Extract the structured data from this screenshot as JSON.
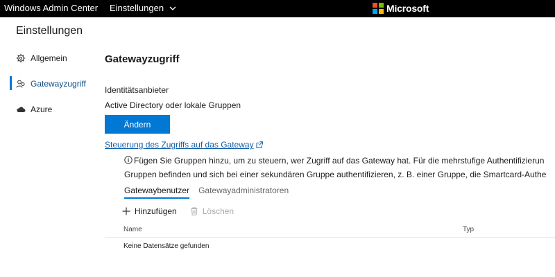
{
  "header": {
    "app_title": "Windows Admin Center",
    "nav_label": "Einstellungen",
    "brand": "Microsoft",
    "brand_colors": [
      "#f25022",
      "#7fba00",
      "#00a4ef",
      "#ffb900"
    ]
  },
  "page": {
    "heading": "Einstellungen"
  },
  "sidebar": {
    "items": [
      {
        "label": "Allgemein",
        "icon": "gear-icon",
        "active": false
      },
      {
        "label": "Gatewayzugriff",
        "icon": "people-icon",
        "active": true
      },
      {
        "label": "Azure",
        "icon": "cloud-icon",
        "active": false
      }
    ]
  },
  "main": {
    "title": "Gatewayzugriff",
    "provider_label": "Identitätsanbieter",
    "provider_value": "Active Directory oder lokale Gruppen",
    "change_button": "Ändern",
    "help_link": "Steuerung des Zugriffs auf das Gateway",
    "info_line1": "Fügen Sie Gruppen hinzu, um zu steuern, wer Zugriff auf das Gateway hat. Für die mehrstufige Authentifizierun",
    "info_line2": "Gruppen befinden und sich bei einer sekundären Gruppe authentifizieren, z. B. einer Gruppe, die Smartcard-Authe",
    "tabs": [
      {
        "label": "Gatewaybenutzer",
        "active": true
      },
      {
        "label": "Gatewayadministratoren",
        "active": false
      }
    ],
    "toolbar": {
      "add_label": "Hinzufügen",
      "delete_label": "Löschen"
    },
    "table": {
      "columns": [
        "Name",
        "Typ"
      ],
      "empty_text": "Keine Datensätze gefunden"
    }
  },
  "colors": {
    "accent": "#0078d4",
    "link": "#0f5ea8",
    "topbar": "#000000"
  }
}
